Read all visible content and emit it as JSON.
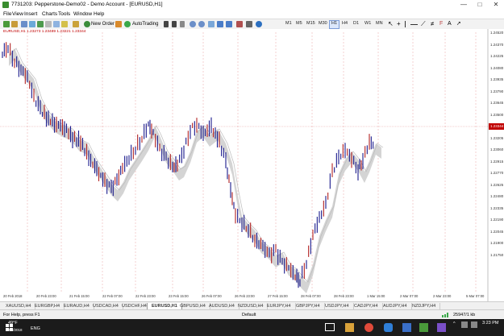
{
  "window": {
    "title": "7731203: Pepperstone-Demo02 - Demo Account - [EURUSD,H1]",
    "minimize": "—",
    "maximize": "□",
    "close": "✕"
  },
  "menu": [
    "File",
    "View",
    "Insert",
    "Charts",
    "Tools",
    "Window",
    "Help"
  ],
  "toolbar": {
    "new_order": "New Order",
    "autotrading": "AutoTrading",
    "timeframes": [
      "M1",
      "M5",
      "M15",
      "M30",
      "H1",
      "H4",
      "D1",
      "W1",
      "MN"
    ],
    "selected_timeframe": "H1"
  },
  "chart": {
    "symbol_label": "EURUSD,H1  1.23273 1.23489 1.23221 1.23344",
    "current_price": "1.23344",
    "price_labels": [
      "1.24520",
      "1.24370",
      "1.24225",
      "1.24080",
      "1.23935",
      "1.23790",
      "1.23645",
      "1.23500",
      "1.23344",
      "1.23205",
      "1.23060",
      "1.22915",
      "1.22770",
      "1.22625",
      "1.22480",
      "1.22335",
      "1.22190",
      "1.22045",
      "1.21900",
      "1.21750"
    ],
    "date_labels": [
      "20 Feb 2018",
      "20 Feb 23:00",
      "21 Feb 15:00",
      "22 Feb 07:00",
      "22 Feb 23:00",
      "23 Feb 15:00",
      "26 Feb 07:00",
      "26 Feb 23:00",
      "27 Feb 15:00",
      "28 Feb 07:00",
      "28 Feb 23:00",
      "1 Mar 15:00",
      "2 Mar 07:00",
      "2 Mar 23:00",
      "5 Mar 07:00"
    ],
    "colors": {
      "bull": "#b22222",
      "bear": "#1a1a8c",
      "cloud": "#cfcfcf",
      "grid": "#e8a0a0",
      "current": "#c00000"
    }
  },
  "tabs": [
    "XAUUSD,H4",
    "EURGBP,H4",
    "EURAUD,H4",
    "USDCAD,H4",
    "USDCHF,H4",
    "EURUSD,H1",
    "GBPUSD,H4",
    "AUDUSD,H4",
    "NZDUSD,H4",
    "EURJPY,H4",
    "GBPJPY,H4",
    "USDJPY,H4",
    "CADJPY,H4",
    "AUDJPY,H4",
    "NZDJPY,H4"
  ],
  "active_tab": "EURUSD,H1",
  "status": {
    "help": "For Help, press F1",
    "profile": "Default",
    "traffic": "25947/1 kb"
  },
  "taskbar": {
    "temp": "49°F",
    "lang": "ENG",
    "time": "3:23 PM",
    "date": "3/5/2018"
  }
}
